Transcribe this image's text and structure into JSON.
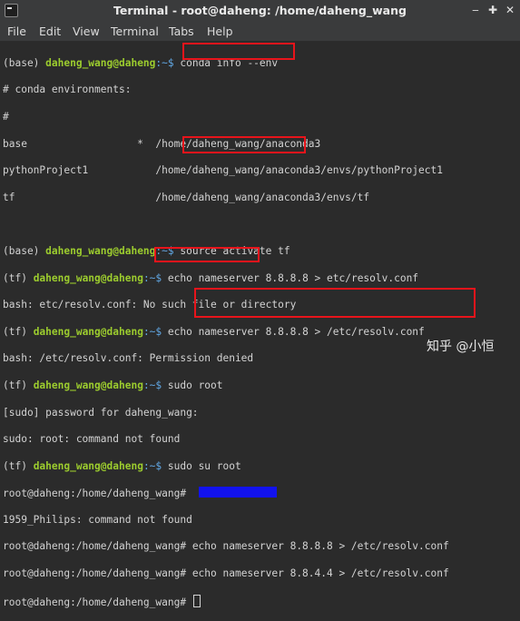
{
  "window": {
    "title": "Terminal - root@daheng: /home/daheng_wang"
  },
  "menu": [
    "File",
    "Edit",
    "View",
    "Terminal",
    "Tabs",
    "Help"
  ],
  "prompt": {
    "base_env": "(base) ",
    "tf_env": "(tf) ",
    "userhost": "daheng_wang@daheng",
    "path_sep": ":~$ ",
    "root": "root@daheng:/home/daheng_wang# "
  },
  "lines": {
    "l1_cmd": "conda info --env",
    "l2": "# conda environments:",
    "l3": "#",
    "l4": "base                  *  /home/daheng_wang/anaconda3",
    "l5": "pythonProject1           /home/daheng_wang/anaconda3/envs/pythonProject1",
    "l6": "tf                       /home/daheng_wang/anaconda3/envs/tf",
    "l8_cmd": "source activate tf",
    "l9_cmd": "echo nameserver 8.8.8.8 > etc/resolv.conf",
    "l10": "bash: etc/resolv.conf: No such file or directory",
    "l11_cmd": "echo nameserver 8.8.8.8 > /etc/resolv.conf",
    "l12": "bash: /etc/resolv.conf: Permission denied",
    "l13_cmd": "sudo root",
    "l14": "[sudo] password for daheng_wang:",
    "l15": "sudo: root: command not found",
    "l16_cmd": "sudo su root",
    "l18": "1959_Philips: command not found",
    "l19_cmd": "echo nameserver 8.8.8.8 > /etc/resolv.conf",
    "l20_cmd": "echo nameserver 8.8.4.4 > /etc/resolv.conf"
  },
  "watermark": "知乎 @小恒",
  "colors": {
    "userhost": "#9ccc2e",
    "path": "#61a8e5",
    "highlight_box": "#e8141b",
    "redaction": "#1212ee"
  }
}
